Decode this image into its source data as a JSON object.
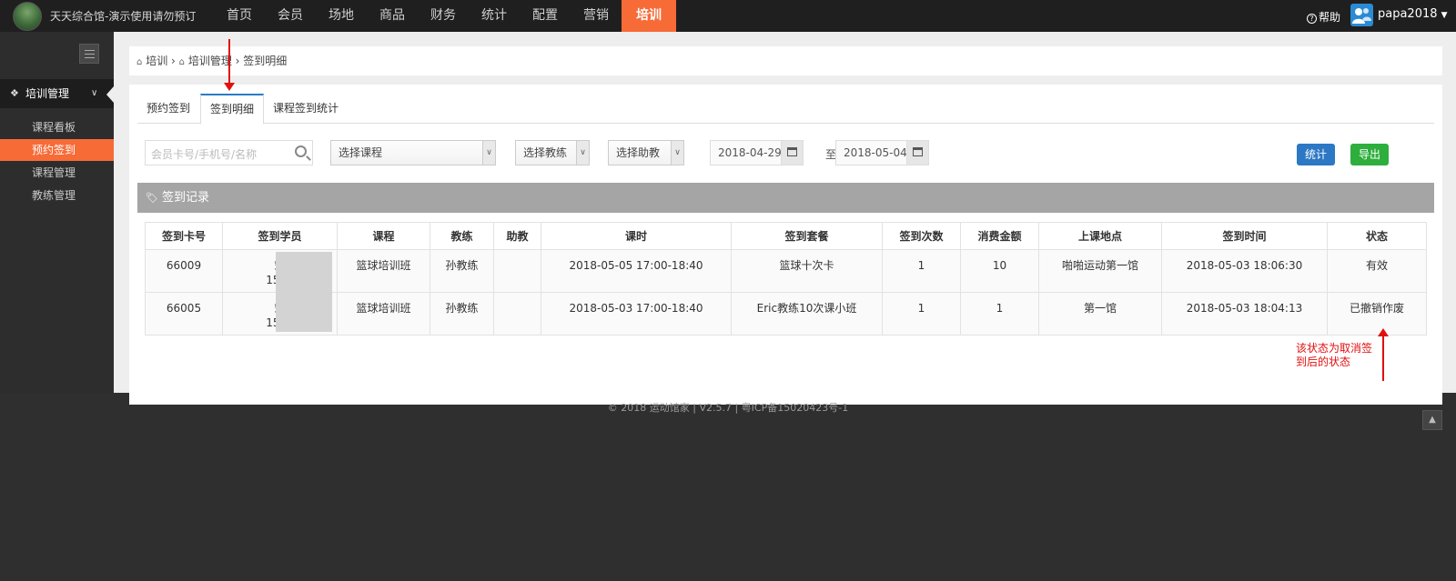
{
  "topbar": {
    "site_title": "天天综合馆-演示使用请勿预订",
    "nav": [
      "首页",
      "会员",
      "场地",
      "商品",
      "财务",
      "统计",
      "配置",
      "营销",
      "培训"
    ],
    "active_nav": "培训",
    "help_label": "帮助",
    "user_name": "papa2018"
  },
  "sidebar": {
    "group_label": "培训管理",
    "items": [
      "课程看板",
      "预约签到",
      "课程管理",
      "教练管理"
    ],
    "active_item": "预约签到"
  },
  "breadcrumb": [
    "培训",
    "培训管理",
    "签到明细"
  ],
  "tabs": [
    "预约签到",
    "签到明细",
    "课程签到统计"
  ],
  "active_tab": "签到明细",
  "filters": {
    "search_placeholder": "会员卡号/手机号/名称",
    "course_select": "选择课程",
    "coach_select": "选择教练",
    "assistant_select": "选择助教",
    "date_from": "2018-04-29",
    "date_sep": "至",
    "date_to": "2018-05-04"
  },
  "buttons": {
    "stats": "统计",
    "export": "导出"
  },
  "section_title": "签到记录",
  "table": {
    "columns": [
      "签到卡号",
      "签到学员",
      "课程",
      "教练",
      "助教",
      "课时",
      "签到套餐",
      "签到次数",
      "消费金额",
      "上课地点",
      "签到时间",
      "状态"
    ],
    "rows": [
      {
        "card": "66009",
        "member": "宋",
        "member_phone": "1581",
        "course": "篮球培训班",
        "coach": "孙教练",
        "assistant": "",
        "session": "2018-05-05 17:00-18:40",
        "package": "篮球十次卡",
        "count": "1",
        "amount": "10",
        "venue": "啪啪运动第一馆",
        "time": "2018-05-03 18:06:30",
        "status": "有效"
      },
      {
        "card": "66005",
        "member": "宋",
        "member_phone": "1581",
        "course": "篮球培训班",
        "coach": "孙教练",
        "assistant": "",
        "session": "2018-05-03 17:00-18:40",
        "package": "Eric教练10次课小班",
        "count": "1",
        "amount": "1",
        "venue": "第一馆",
        "time": "2018-05-03 18:04:13",
        "status": "已撤销作废"
      }
    ]
  },
  "annotation": "该状态为取消签到后的状态",
  "footer": "© 2018 运动馆家 | V2.5.7 | 粤ICP备15020423号-1",
  "colors": {
    "accent": "#f76b37",
    "primary": "#2c78c4",
    "success": "#2eae3c",
    "annotation": "#e10f0f"
  }
}
